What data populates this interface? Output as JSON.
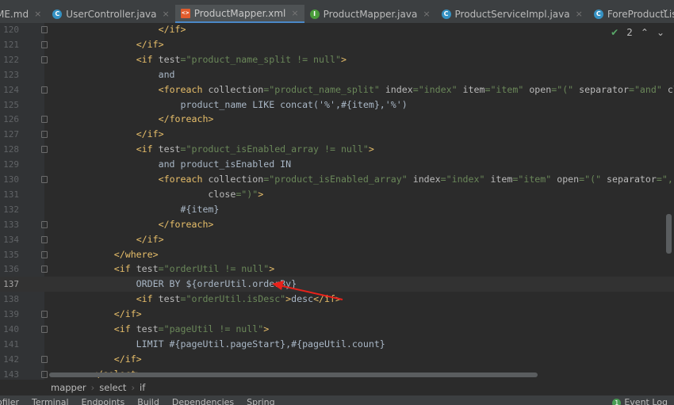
{
  "tabs": [
    {
      "label": "ME.md",
      "icon": "markdown-icon",
      "type": "none"
    },
    {
      "label": "UserController.java",
      "icon": "class-icon",
      "type": "c"
    },
    {
      "label": "ProductMapper.xml",
      "icon": "xml-file-icon",
      "type": "x",
      "active": true
    },
    {
      "label": "ProductMapper.java",
      "icon": "interface-icon",
      "type": "i"
    },
    {
      "label": "ProductServiceImpl.java",
      "icon": "class-icon",
      "type": "c"
    },
    {
      "label": "ForeProductListController.java",
      "icon": "class-icon",
      "type": "c"
    }
  ],
  "inspection": {
    "count": "2",
    "icon": "check-icon"
  },
  "current_line": 137,
  "code": [
    {
      "n": 120,
      "fold": true,
      "tok": [
        [
          "p",
          "                    "
        ],
        [
          "t",
          "</if>"
        ]
      ]
    },
    {
      "n": 121,
      "fold": true,
      "tok": [
        [
          "p",
          "                "
        ],
        [
          "t",
          "</if>"
        ]
      ]
    },
    {
      "n": 122,
      "fold": true,
      "tok": [
        [
          "p",
          "                "
        ],
        [
          "t",
          "<if "
        ],
        [
          "a",
          "test"
        ],
        [
          "v",
          "=\"product_name_split != null\""
        ],
        [
          "t",
          ">"
        ]
      ]
    },
    {
      "n": 123,
      "tok": [
        [
          "p",
          "                    and"
        ]
      ]
    },
    {
      "n": 124,
      "fold": true,
      "tok": [
        [
          "p",
          "                    "
        ],
        [
          "t",
          "<foreach "
        ],
        [
          "a",
          "collection"
        ],
        [
          "v",
          "=\"product_name_split\" "
        ],
        [
          "a",
          "index"
        ],
        [
          "v",
          "=\"index\" "
        ],
        [
          "a",
          "item"
        ],
        [
          "v",
          "=\"item\" "
        ],
        [
          "a",
          "open"
        ],
        [
          "v",
          "=\"(\" "
        ],
        [
          "a",
          "separator"
        ],
        [
          "v",
          "=\"and\" "
        ],
        [
          "a",
          "close"
        ],
        [
          "v",
          "=\")\""
        ],
        [
          "t",
          ">"
        ]
      ]
    },
    {
      "n": 125,
      "tok": [
        [
          "p",
          "                        product_name LIKE concat('%',#{item},'%')"
        ]
      ]
    },
    {
      "n": 126,
      "fold": true,
      "tok": [
        [
          "p",
          "                    "
        ],
        [
          "t",
          "</foreach>"
        ]
      ]
    },
    {
      "n": 127,
      "fold": true,
      "tok": [
        [
          "p",
          "                "
        ],
        [
          "t",
          "</if>"
        ]
      ]
    },
    {
      "n": 128,
      "fold": true,
      "tok": [
        [
          "p",
          "                "
        ],
        [
          "t",
          "<if "
        ],
        [
          "a",
          "test"
        ],
        [
          "v",
          "=\"product_isEnabled_array != null\""
        ],
        [
          "t",
          ">"
        ]
      ]
    },
    {
      "n": 129,
      "tok": [
        [
          "p",
          "                    and product_isEnabled IN"
        ]
      ]
    },
    {
      "n": 130,
      "fold": true,
      "tok": [
        [
          "p",
          "                    "
        ],
        [
          "t",
          "<foreach "
        ],
        [
          "a",
          "collection"
        ],
        [
          "v",
          "=\"product_isEnabled_array\" "
        ],
        [
          "a",
          "index"
        ],
        [
          "v",
          "=\"index\" "
        ],
        [
          "a",
          "item"
        ],
        [
          "v",
          "=\"item\" "
        ],
        [
          "a",
          "open"
        ],
        [
          "v",
          "=\"(\" "
        ],
        [
          "a",
          "separator"
        ],
        [
          "v",
          "=\",\""
        ]
      ]
    },
    {
      "n": 131,
      "tok": [
        [
          "p",
          "                             "
        ],
        [
          "a",
          "close"
        ],
        [
          "v",
          "=\")\""
        ],
        [
          "t",
          ">"
        ]
      ]
    },
    {
      "n": 132,
      "tok": [
        [
          "p",
          "                        #{item}"
        ]
      ]
    },
    {
      "n": 133,
      "fold": true,
      "tok": [
        [
          "p",
          "                    "
        ],
        [
          "t",
          "</foreach>"
        ]
      ]
    },
    {
      "n": 134,
      "fold": true,
      "tok": [
        [
          "p",
          "                "
        ],
        [
          "t",
          "</if>"
        ]
      ]
    },
    {
      "n": 135,
      "fold": true,
      "tok": [
        [
          "p",
          "            "
        ],
        [
          "t",
          "</where>"
        ]
      ]
    },
    {
      "n": 136,
      "fold": true,
      "tok": [
        [
          "p",
          "            "
        ],
        [
          "t",
          "<if "
        ],
        [
          "a",
          "test"
        ],
        [
          "v",
          "=\"orderUtil != null\""
        ],
        [
          "t",
          ">"
        ]
      ]
    },
    {
      "n": 137,
      "tok": [
        [
          "p",
          "                ORDER BY ${orderUtil.orderBy}"
        ]
      ]
    },
    {
      "n": 138,
      "tok": [
        [
          "p",
          "                "
        ],
        [
          "t",
          "<if "
        ],
        [
          "a",
          "test"
        ],
        [
          "v",
          "=\"orderUtil.isDesc\""
        ],
        [
          "t",
          ">"
        ],
        [
          "p",
          "desc"
        ],
        [
          "t",
          "</if>"
        ]
      ]
    },
    {
      "n": 139,
      "fold": true,
      "tok": [
        [
          "p",
          "            "
        ],
        [
          "t",
          "</if>"
        ]
      ]
    },
    {
      "n": 140,
      "fold": true,
      "tok": [
        [
          "p",
          "            "
        ],
        [
          "t",
          "<if "
        ],
        [
          "a",
          "test"
        ],
        [
          "v",
          "=\"pageUtil != null\""
        ],
        [
          "t",
          ">"
        ]
      ]
    },
    {
      "n": 141,
      "tok": [
        [
          "p",
          "                LIMIT #{pageUtil.pageStart},#{pageUtil.count}"
        ]
      ]
    },
    {
      "n": 142,
      "fold": true,
      "tok": [
        [
          "p",
          "            "
        ],
        [
          "t",
          "</if>"
        ]
      ]
    },
    {
      "n": 143,
      "fold": true,
      "tok": [
        [
          "p",
          "        "
        ],
        [
          "t",
          "</select>"
        ]
      ]
    }
  ],
  "breadcrumb": [
    "mapper",
    "select",
    "if"
  ],
  "tool_windows": [
    "ofiler",
    "Terminal",
    "Endpoints",
    "Build",
    "Dependencies",
    "Spring"
  ],
  "event_log": {
    "label": "Event Log",
    "count": "1"
  },
  "colors": {
    "background": "#2b2b2b",
    "tag": "#e8bf6a",
    "attribute": "#bababa",
    "value": "#6a8759",
    "text": "#a9b7c6",
    "annotation_arrow": "#e8221b",
    "active_tab": "#4a88c7"
  }
}
